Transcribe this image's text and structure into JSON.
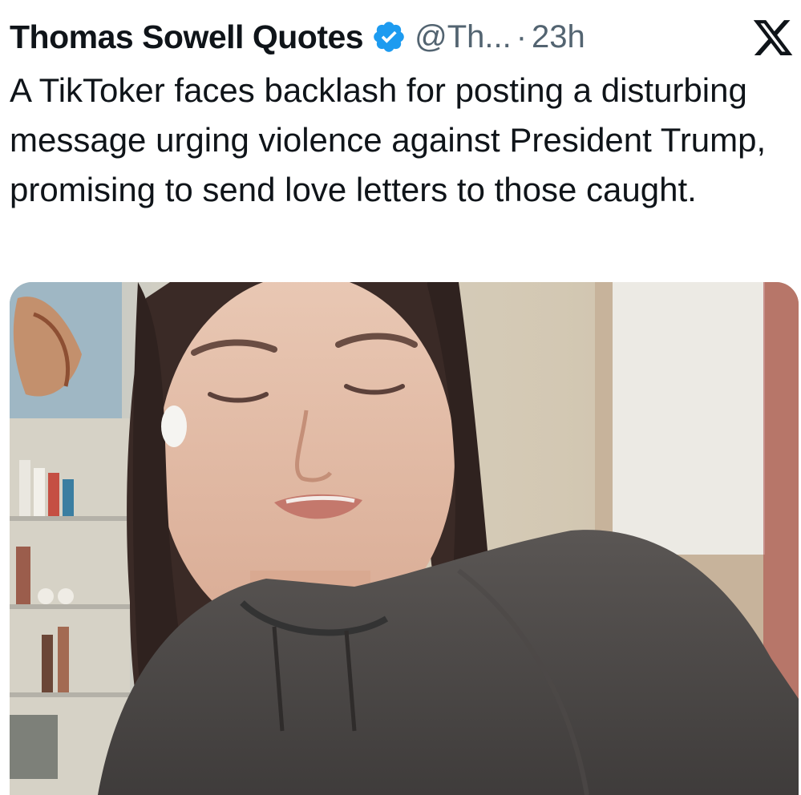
{
  "tweet": {
    "author_name": "Thomas Sowell Quotes",
    "handle": "@Th...",
    "separator": "·",
    "time": "23h",
    "text": "A TikToker faces backlash for posting a disturbing message urging violence against President Trump, promising to send love letters to those caught.",
    "verified": true,
    "verified_icon": "verified-badge-icon",
    "platform_icon": "x-logo-icon"
  },
  "colors": {
    "text_primary": "#0f1419",
    "text_secondary": "#536471",
    "verified_blue": "#1d9bf0"
  }
}
